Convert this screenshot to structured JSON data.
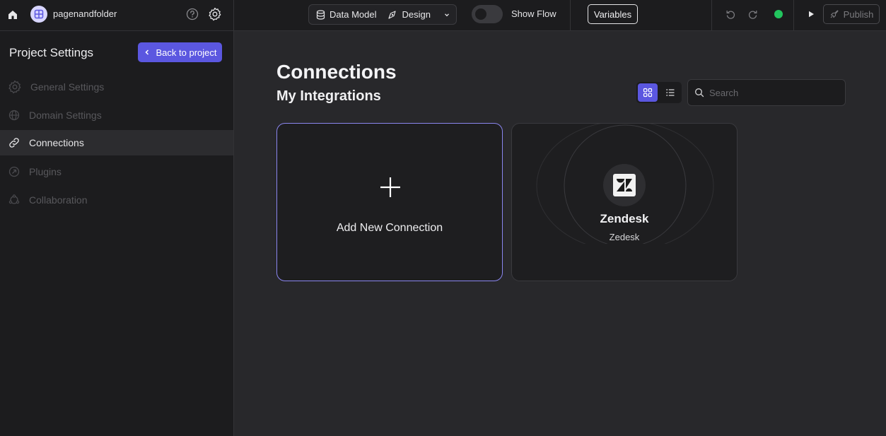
{
  "topbar": {
    "project_name": "pagenandfolder",
    "data_model_label": "Data Model",
    "design_label": "Design",
    "show_flow_label": "Show Flow",
    "show_flow_on": false,
    "variables_label": "Variables",
    "publish_label": "Publish",
    "status_color": "#22c55e",
    "icons": [
      "home-icon",
      "project-avatar-icon",
      "help-icon",
      "gear-icon",
      "database-icon",
      "design-icon",
      "chevron-down-icon",
      "undo-icon",
      "redo-icon",
      "play-icon",
      "rocket-icon"
    ]
  },
  "sidebar": {
    "title": "Project Settings",
    "back_label": "Back to project",
    "items": [
      {
        "label": "General Settings",
        "icon": "gear-icon",
        "active": false
      },
      {
        "label": "Domain Settings",
        "icon": "globe-icon",
        "active": false
      },
      {
        "label": "Connections",
        "icon": "link-icon",
        "active": true
      },
      {
        "label": "Plugins",
        "icon": "plugin-icon",
        "active": false
      },
      {
        "label": "Collaboration",
        "icon": "collaboration-icon",
        "active": false
      }
    ]
  },
  "main": {
    "title": "Connections",
    "subtitle": "My Integrations",
    "view_mode": "grid",
    "search_placeholder": "Search",
    "add_card_label": "Add New Connection",
    "connections": [
      {
        "name": "Zendesk",
        "subtitle": "Zedesk",
        "icon": "zendesk-logo-icon"
      }
    ]
  },
  "colors": {
    "accent": "#5b57e0",
    "background": "#28282b",
    "panel": "#1c1c1e"
  }
}
